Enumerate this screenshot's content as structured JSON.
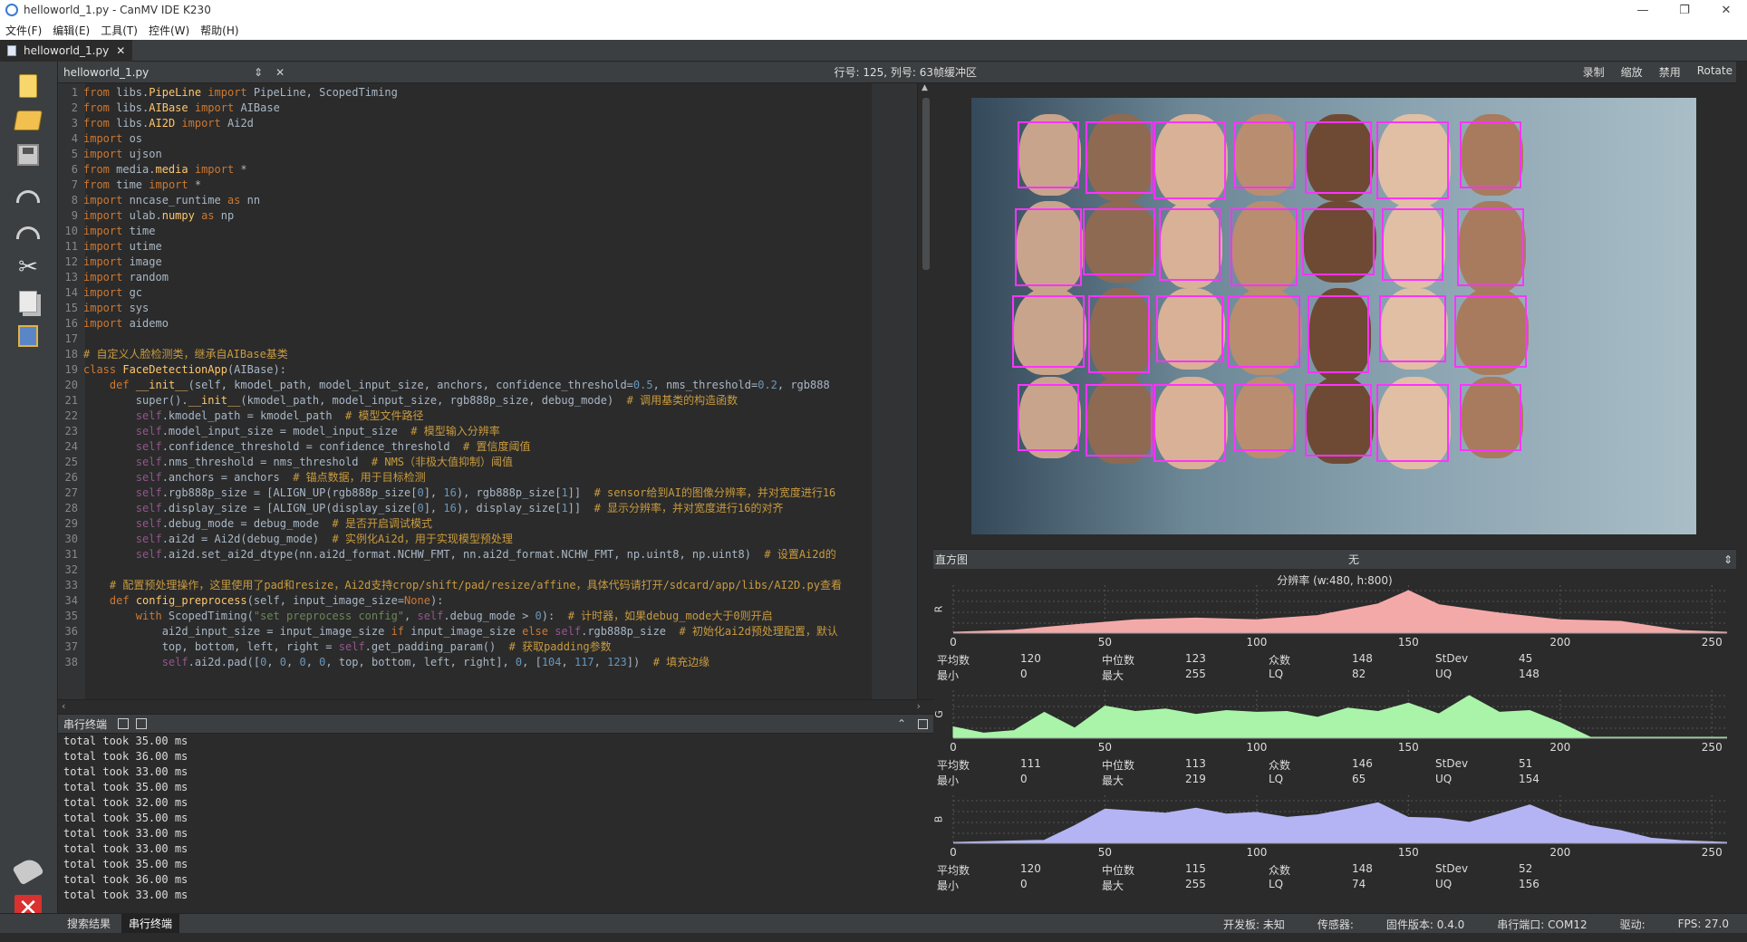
{
  "window": {
    "title": "helloworld_1.py - CanMV IDE K230",
    "controls": [
      "—",
      "❐",
      "✕"
    ]
  },
  "menu": [
    "文件(F)",
    "编辑(E)",
    "工具(T)",
    "控件(W)",
    "帮助(H)"
  ],
  "file_tab": {
    "name": "helloworld_1.py",
    "close": "✕"
  },
  "editor_header": {
    "filename": "helloworld_1.py",
    "updown": "⇕",
    "close": "✕",
    "position": "行号: 125, 列号: 63",
    "framebuffer_label": "帧缓冲区"
  },
  "code_lines": [
    {
      "n": "1",
      "html": "<span class=\"kw\">from</span> libs.<span class=\"md\">PipeLine</span> <span class=\"kw\">import</span> PipeLine, ScopedTiming"
    },
    {
      "n": "2",
      "html": "<span class=\"kw\">from</span> libs.<span class=\"md\">AIBase</span> <span class=\"kw\">import</span> AIBase"
    },
    {
      "n": "3",
      "html": "<span class=\"kw\">from</span> libs.<span class=\"md\">AI2D</span> <span class=\"kw\">import</span> Ai2d"
    },
    {
      "n": "4",
      "html": "<span class=\"kw\">import</span> os"
    },
    {
      "n": "5",
      "html": "<span class=\"kw\">import</span> ujson"
    },
    {
      "n": "6",
      "html": "<span class=\"kw\">from</span> media.<span class=\"md\">media</span> <span class=\"kw\">import</span> *"
    },
    {
      "n": "7",
      "html": "<span class=\"kw\">from</span> time <span class=\"kw\">import</span> *"
    },
    {
      "n": "8",
      "html": "<span class=\"kw\">import</span> nncase_runtime <span class=\"kw\">as</span> nn"
    },
    {
      "n": "9",
      "html": "<span class=\"kw\">import</span> ulab.<span class=\"md\">numpy</span> <span class=\"kw\">as</span> np"
    },
    {
      "n": "10",
      "html": "<span class=\"kw\">import</span> time"
    },
    {
      "n": "11",
      "html": "<span class=\"kw\">import</span> utime"
    },
    {
      "n": "12",
      "html": "<span class=\"kw\">import</span> image"
    },
    {
      "n": "13",
      "html": "<span class=\"kw\">import</span> random"
    },
    {
      "n": "14",
      "html": "<span class=\"kw\">import</span> gc"
    },
    {
      "n": "15",
      "html": "<span class=\"kw\">import</span> sys"
    },
    {
      "n": "16",
      "html": "<span class=\"kw\">import</span> aidemo"
    },
    {
      "n": "17",
      "html": ""
    },
    {
      "n": "18",
      "html": "<span class=\"cm\"># 自定义人脸检测类，继承自AIBase基类</span>"
    },
    {
      "n": "19",
      "html": "<span class=\"kw\">class</span> <span class=\"md\">FaceDetectionApp</span>(AIBase):"
    },
    {
      "n": "20",
      "html": "    <span class=\"kw\">def</span> <span class=\"md\">__init__</span>(self, kmodel_path, model_input_size, anchors, confidence_threshold=<span class=\"nm\">0.5</span>, nms_threshold=<span class=\"nm\">0.2</span>, rgb888"
    },
    {
      "n": "21",
      "html": "        super().<span class=\"md\">__init__</span>(kmodel_path, model_input_size, rgb888p_size, debug_mode)  <span class=\"cm\"># 调用基类的构造函数</span>"
    },
    {
      "n": "22",
      "html": "        <span class=\"sf\">self</span>.kmodel_path = kmodel_path  <span class=\"cm\"># 模型文件路径</span>"
    },
    {
      "n": "23",
      "html": "        <span class=\"sf\">self</span>.model_input_size = model_input_size  <span class=\"cm\"># 模型输入分辨率</span>"
    },
    {
      "n": "24",
      "html": "        <span class=\"sf\">self</span>.confidence_threshold = confidence_threshold  <span class=\"cm\"># 置信度阈值</span>"
    },
    {
      "n": "25",
      "html": "        <span class=\"sf\">self</span>.nms_threshold = nms_threshold  <span class=\"cm\"># NMS（非极大值抑制）阈值</span>"
    },
    {
      "n": "26",
      "html": "        <span class=\"sf\">self</span>.anchors = anchors  <span class=\"cm\"># 锚点数据，用于目标检测</span>"
    },
    {
      "n": "27",
      "html": "        <span class=\"sf\">self</span>.rgb888p_size = [ALIGN_UP(rgb888p_size[<span class=\"nm\">0</span>], <span class=\"nm\">16</span>), rgb888p_size[<span class=\"nm\">1</span>]]  <span class=\"cm\"># sensor给到AI的图像分辨率，并对宽度进行16</span>"
    },
    {
      "n": "28",
      "html": "        <span class=\"sf\">self</span>.display_size = [ALIGN_UP(display_size[<span class=\"nm\">0</span>], <span class=\"nm\">16</span>), display_size[<span class=\"nm\">1</span>]]  <span class=\"cm\"># 显示分辨率，并对宽度进行16的对齐</span>"
    },
    {
      "n": "29",
      "html": "        <span class=\"sf\">self</span>.debug_mode = debug_mode  <span class=\"cm\"># 是否开启调试模式</span>"
    },
    {
      "n": "30",
      "html": "        <span class=\"sf\">self</span>.ai2d = Ai2d(debug_mode)  <span class=\"cm\"># 实例化Ai2d，用于实现模型预处理</span>"
    },
    {
      "n": "31",
      "html": "        <span class=\"sf\">self</span>.ai2d.set_ai2d_dtype(nn.ai2d_format.NCHW_FMT, nn.ai2d_format.NCHW_FMT, np.uint8, np.uint8)  <span class=\"cm\"># 设置Ai2d的</span>"
    },
    {
      "n": "32",
      "html": ""
    },
    {
      "n": "33",
      "html": "    <span class=\"cm\"># 配置预处理操作，这里使用了pad和resize，Ai2d支持crop/shift/pad/resize/affine，具体代码请打开/sdcard/app/libs/AI2D.py查看</span>"
    },
    {
      "n": "34",
      "html": "    <span class=\"kw\">def</span> <span class=\"md\">config_preprocess</span>(self, input_image_size=<span class=\"kw\">None</span>):"
    },
    {
      "n": "35",
      "html": "        <span class=\"kw\">with</span> ScopedTiming(<span class=\"st\">\"set preprocess config\"</span>, <span class=\"sf\">self</span>.debug_mode > <span class=\"nm\">0</span>):  <span class=\"cm\"># 计时器，如果debug_mode大于0则开启</span>"
    },
    {
      "n": "36",
      "html": "            ai2d_input_size = input_image_size <span class=\"kw\">if</span> input_image_size <span class=\"kw\">else</span> <span class=\"sf\">self</span>.rgb888p_size  <span class=\"cm\"># 初始化ai2d预处理配置，默认</span>"
    },
    {
      "n": "37",
      "html": "            top, bottom, left, right = <span class=\"sf\">self</span>.get_padding_param()  <span class=\"cm\"># 获取padding参数</span>"
    },
    {
      "n": "38",
      "html": "            <span class=\"sf\">self</span>.ai2d.pad([<span class=\"nm\">0</span>, <span class=\"nm\">0</span>, <span class=\"nm\">0</span>, <span class=\"nm\">0</span>, top, bottom, left, right], <span class=\"nm\">0</span>, [<span class=\"nm\">104</span>, <span class=\"nm\">117</span>, <span class=\"nm\">123</span>])  <span class=\"cm\"># 填充边缘</span>"
    }
  ],
  "terminal": {
    "title": "串行终端",
    "lines": [
      "total took 35.00 ms",
      "total took 36.00 ms",
      "total took 33.00 ms",
      "total took 35.00 ms",
      "total took 32.00 ms",
      "total took 35.00 ms",
      "total took 33.00 ms",
      "total took 33.00 ms",
      "total took 35.00 ms",
      "total took 36.00 ms",
      "total took 33.00 ms"
    ]
  },
  "bottom_tabs": [
    "搜索结果",
    "串行终端"
  ],
  "status": {
    "board": "开发板: 未知",
    "sensor": "传感器:",
    "firmware": "固件版本: 0.4.0",
    "serial_port": "串行端口: COM12",
    "driver": "驱动:",
    "fps": "FPS:  27.0"
  },
  "framebuffer": {
    "actions": [
      "录制",
      "缩放",
      "禁用",
      "Rotate"
    ]
  },
  "histogram": {
    "label": "直方图",
    "mode": "无",
    "resolution": "分辨率 (w:480, h:800)"
  },
  "chart_data": {
    "type": "area",
    "x_ticks": [
      "0",
      "50",
      "100",
      "150",
      "200",
      "250"
    ],
    "xlim": [
      0,
      255
    ],
    "series": [
      {
        "name": "R",
        "color": "#f4a9a9",
        "x": [
          0,
          20,
          40,
          60,
          80,
          100,
          120,
          140,
          150,
          160,
          180,
          200,
          220,
          240,
          255
        ],
        "values": [
          0,
          5,
          18,
          30,
          34,
          30,
          40,
          68,
          100,
          66,
          46,
          30,
          26,
          4,
          0
        ]
      },
      {
        "name": "G",
        "color": "#a9f4a9",
        "x": [
          0,
          10,
          20,
          30,
          40,
          50,
          60,
          70,
          80,
          90,
          100,
          110,
          120,
          130,
          140,
          150,
          160,
          170,
          180,
          190,
          200,
          210,
          220,
          240,
          255
        ],
        "values": [
          25,
          10,
          16,
          60,
          22,
          75,
          62,
          68,
          55,
          64,
          60,
          62,
          48,
          70,
          62,
          82,
          56,
          100,
          60,
          64,
          35,
          0,
          0,
          0,
          0
        ]
      },
      {
        "name": "B",
        "color": "#b4b4f4",
        "x": [
          0,
          30,
          40,
          50,
          60,
          70,
          80,
          90,
          100,
          110,
          120,
          130,
          140,
          150,
          160,
          170,
          180,
          190,
          200,
          210,
          220,
          230,
          240,
          255
        ],
        "values": [
          0,
          5,
          40,
          80,
          75,
          70,
          82,
          68,
          72,
          60,
          66,
          80,
          95,
          60,
          58,
          48,
          68,
          90,
          60,
          40,
          28,
          10,
          4,
          0
        ]
      }
    ],
    "stats": [
      {
        "channel": "R",
        "mean": "120",
        "median": "123",
        "mode": "148",
        "stdev": "45",
        "min": "0",
        "max": "255",
        "lq": "82",
        "uq": "148"
      },
      {
        "channel": "G",
        "mean": "111",
        "median": "113",
        "mode": "146",
        "stdev": "51",
        "min": "0",
        "max": "219",
        "lq": "65",
        "uq": "154"
      },
      {
        "channel": "B",
        "mean": "120",
        "median": "115",
        "mode": "148",
        "stdev": "52",
        "min": "0",
        "max": "255",
        "lq": "74",
        "uq": "156"
      }
    ],
    "stat_labels": {
      "mean": "平均数",
      "median": "中位数",
      "mode": "众数",
      "stdev": "StDev",
      "min": "最小",
      "max": "最大",
      "lq": "LQ",
      "uq": "UQ"
    }
  },
  "colors": {
    "face_box": "#ff33ff",
    "keyword": "#cc7832",
    "comment": "#c99b3f"
  }
}
